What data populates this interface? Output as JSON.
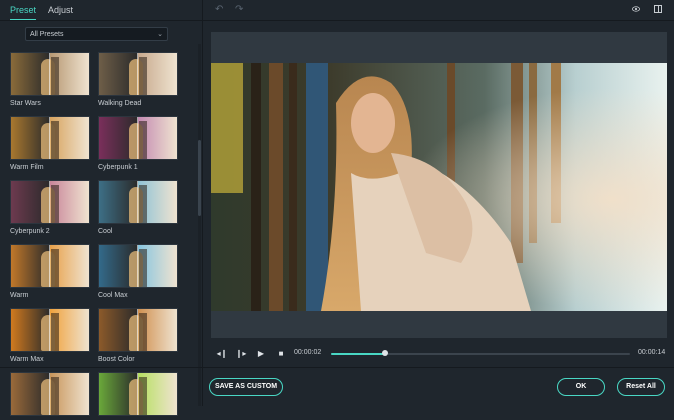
{
  "left": {
    "tabs": [
      {
        "label": "Preset",
        "active": true
      },
      {
        "label": "Adjust",
        "active": false
      }
    ],
    "preset_select": {
      "value": "All Presets"
    },
    "presets": [
      {
        "label": "Star Wars",
        "left": "#8a6b3a",
        "right": "#b79873"
      },
      {
        "label": "Walking Dead",
        "left": "#6e5e48",
        "right": "#c7a98d"
      },
      {
        "label": "Warm Film",
        "left": "#a9782f",
        "right": "#d8a45f"
      },
      {
        "label": "Cyberpunk 1",
        "left": "#7a2f5b",
        "right": "#c48ab2"
      },
      {
        "label": "Cyberpunk 2",
        "left": "#6d3a4f",
        "right": "#c9859a"
      },
      {
        "label": "Cool",
        "left": "#3d6f86",
        "right": "#8fc3d6"
      },
      {
        "label": "Warm",
        "left": "#c1782a",
        "right": "#e8a14a"
      },
      {
        "label": "Cool Max",
        "left": "#336a8a",
        "right": "#86c5e0"
      },
      {
        "label": "Warm Max",
        "left": "#d07a1f",
        "right": "#f0a23c"
      },
      {
        "label": "Boost Color",
        "left": "#8c5a2a",
        "right": "#d09050"
      },
      {
        "label": "",
        "left": "#9a6a3a",
        "right": "#c8955a"
      },
      {
        "label": "",
        "left": "#6aa83a",
        "right": "#b6e060"
      }
    ]
  },
  "right": {
    "undo_label": "↶",
    "redo_label": "↷",
    "player": {
      "current_time": "00:00:02",
      "total_time": "00:00:14",
      "progress": 0.18
    },
    "buttons": {
      "save_custom": "SAVE AS CUSTOM",
      "ok": "OK",
      "reset_all": "Reset All"
    }
  },
  "colors": {
    "accent": "#49d7c4",
    "panel": "#1f262d",
    "preview_bg": "#303941"
  }
}
